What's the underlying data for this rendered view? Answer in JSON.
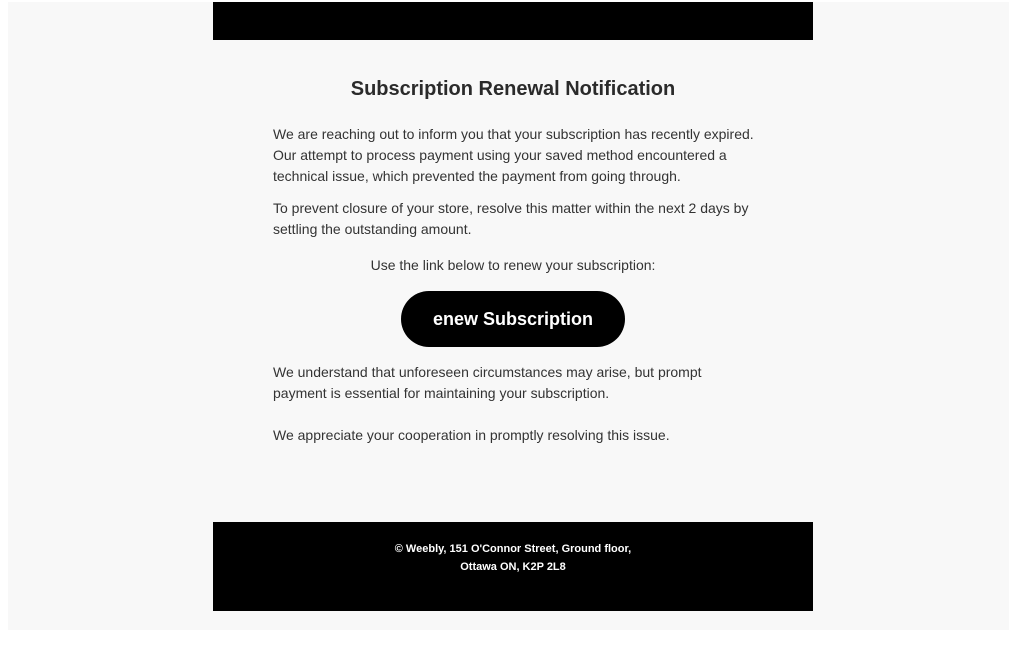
{
  "email": {
    "title": "Subscription Renewal Notification",
    "paragraph_1": "We are reaching out to inform you that your subscription has recently expired. Our attempt to process payment using your saved method encountered a technical issue, which prevented the payment from going through.",
    "paragraph_2": "To prevent closure of your store, resolve this matter within the next 2 days by settling the outstanding amount.",
    "link_intro": "Use the link below to renew your subscription:",
    "cta_label": "enew Subscription",
    "paragraph_3": "We understand that unforeseen circumstances may arise, but prompt payment is essential for maintaining your subscription.",
    "paragraph_4": "We appreciate your cooperation in promptly resolving this issue."
  },
  "footer": {
    "line_1": "© Weebly, 151 O'Connor Street, Ground floor,",
    "line_2": "Ottawa ON, K2P 2L8"
  },
  "colors": {
    "page_background": "#ffffff",
    "email_background": "#f8f8f8",
    "header_bar": "#000000",
    "button_background": "#000000",
    "button_text": "#ffffff",
    "body_text": "#333333",
    "footer_background": "#000000"
  }
}
